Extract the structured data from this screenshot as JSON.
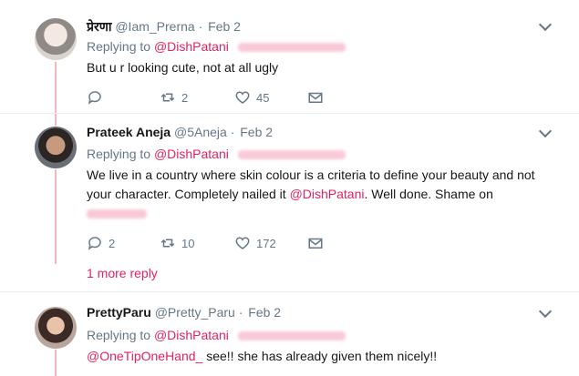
{
  "tweets": [
    {
      "display_name": "प्रेरणा",
      "handle": "@Iam_Prerna",
      "date": "Feb 2",
      "replying_label": "Replying to",
      "replying_mention": "@DishPatani",
      "text": "But u r looking cute, not at all ugly",
      "reply_count": "",
      "retweet_count": "2",
      "like_count": "45"
    },
    {
      "display_name": "Prateek Aneja",
      "handle": "@5Aneja",
      "date": "Feb 2",
      "replying_label": "Replying to",
      "replying_mention": "@DishPatani",
      "text_line1": "We live in a country where skin colour is a criteria to define your beauty and not",
      "text_line2_pre": "your character. Completely nailed it ",
      "text_line2_mention": "@DishPatani",
      "text_line2_post": ". Well done. Shame on",
      "reply_count": "2",
      "retweet_count": "10",
      "like_count": "172"
    },
    {
      "display_name": "PrettyParu",
      "handle": "@Pretty_Paru",
      "date": "Feb 2",
      "replying_label": "Replying to",
      "replying_mention": "@DishPatani",
      "text_mention": "@OneTipOneHand_",
      "text_post": " see!! she has already given them nicely!!"
    }
  ],
  "more_replies": "1 more reply",
  "colors": {
    "accent": "#e0245e",
    "muted": "#657786",
    "thread": "#f5b5c3"
  }
}
